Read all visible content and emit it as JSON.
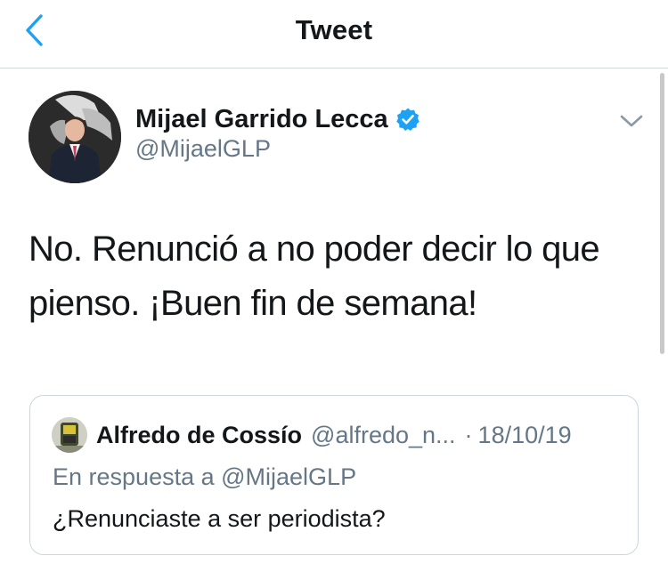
{
  "header": {
    "title": "Tweet",
    "back_icon": "chevron-left-icon"
  },
  "colors": {
    "accent": "#1da1f2",
    "secondary_text": "#657786",
    "primary_text": "#14171a",
    "divider": "#ccd6dd"
  },
  "tweet": {
    "author_name": "Mijael Garrido Lecca",
    "author_handle": "@MijaelGLP",
    "verified": true,
    "text": "No. Renunció a no poder decir lo que pienso. ¡Buen fin de semana!"
  },
  "quoted_tweet": {
    "author_name": "Alfredo de Cossío",
    "author_handle": "@alfredo_n...",
    "separator": "·",
    "date": "18/10/19",
    "reply_to": "En respuesta a @MijaelGLP",
    "text": "¿Renunciaste a ser periodista?"
  }
}
